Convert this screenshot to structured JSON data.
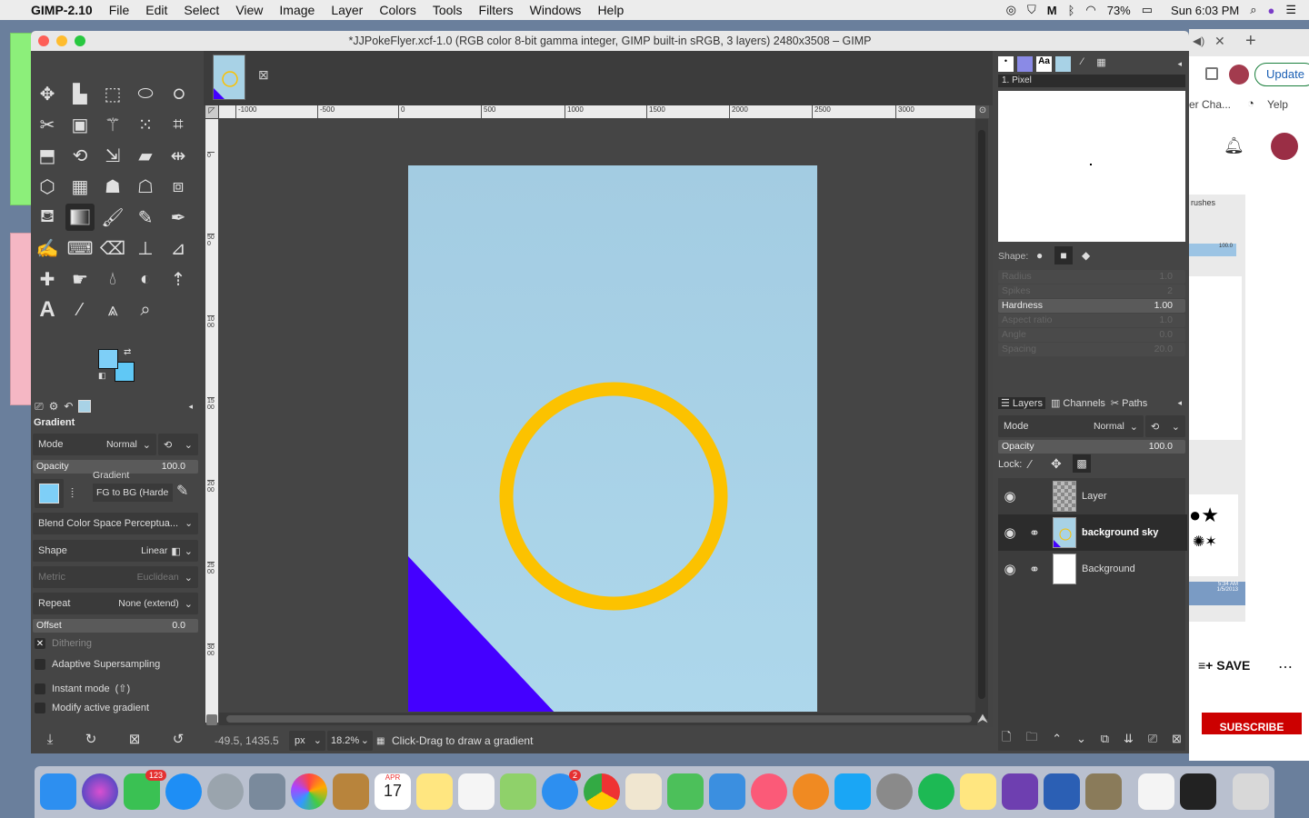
{
  "menubar": {
    "app_name": "GIMP-2.10",
    "items": [
      "File",
      "Edit",
      "Select",
      "View",
      "Image",
      "Layer",
      "Colors",
      "Tools",
      "Filters",
      "Windows",
      "Help"
    ],
    "battery": "73%",
    "clock": "Sun 6:03 PM"
  },
  "window": {
    "title": "*JJPokeFlyer.xcf-1.0 (RGB color 8-bit gamma integer, GIMP built-in sRGB, 3 layers) 2480x3508 – GIMP"
  },
  "tool_options": {
    "section_title": "Gradient",
    "mode_label": "Mode",
    "mode_value": "Normal",
    "opacity_label": "Opacity",
    "opacity_value": "100.0",
    "gradient_label": "Gradient",
    "gradient_value": "FG to BG (Harde",
    "blend_color_space": "Blend Color Space Perceptua...",
    "shape_label": "Shape",
    "shape_value": "Linear",
    "metric_label": "Metric",
    "metric_value": "Euclidean",
    "repeat_label": "Repeat",
    "repeat_value": "None (extend)",
    "offset_label": "Offset",
    "offset_value": "0.0",
    "dithering": "Dithering",
    "adaptive": "Adaptive Supersampling",
    "instant": "Instant mode",
    "instant_hint": "(⇧)",
    "modify": "Modify active gradient"
  },
  "ruler": {
    "h_ticks": [
      "-1000",
      "-500",
      "0",
      "500",
      "1000",
      "1500",
      "2000",
      "2500",
      "3000"
    ],
    "v_ticks": [
      "0",
      "500",
      "1000",
      "1500",
      "2000",
      "2500",
      "3000"
    ]
  },
  "status": {
    "coords": "-49.5, 1435.5",
    "unit": "px",
    "zoom": "18.2%",
    "message": "Click-Drag to draw a gradient"
  },
  "brushes": {
    "selected_brush": "1. Pixel",
    "shape_label": "Shape:",
    "radius_label": "Radius",
    "radius_value": "1.0",
    "spikes_label": "Spikes",
    "spikes_value": "2",
    "hardness_label": "Hardness",
    "hardness_value": "1.00",
    "aspect_label": "Aspect ratio",
    "aspect_value": "1.0",
    "angle_label": "Angle",
    "angle_value": "0.0",
    "spacing_label": "Spacing",
    "spacing_value": "20.0"
  },
  "layers_panel": {
    "tabs": [
      "Layers",
      "Channels",
      "Paths"
    ],
    "mode_label": "Mode",
    "mode_value": "Normal",
    "opacity_label": "Opacity",
    "opacity_value": "100.0",
    "lock_label": "Lock:",
    "layers": [
      {
        "name": "Layer",
        "selected": false
      },
      {
        "name": "background sky",
        "selected": true
      },
      {
        "name": "Background",
        "selected": false
      }
    ]
  },
  "browser": {
    "update_button": "Update",
    "tab_text": "er Cha...",
    "yelp": "Yelp",
    "save": "SAVE",
    "subscribe": "SUBSCRIBE",
    "brushes_fragment": "rushes",
    "fragment_value": "100.0",
    "time_fragment": "5:34 AM",
    "date_fragment": "1/5/2013"
  },
  "dock": {
    "facetime_badge": "123",
    "messages_badge": "2",
    "calendar_month": "APR",
    "calendar_day": "17"
  },
  "colors": {
    "fg": "#7ecff7",
    "bg": "#60c8f5",
    "sky": "#a8d2e6",
    "circle": "#fcc200",
    "wedge": "#4400ff"
  }
}
